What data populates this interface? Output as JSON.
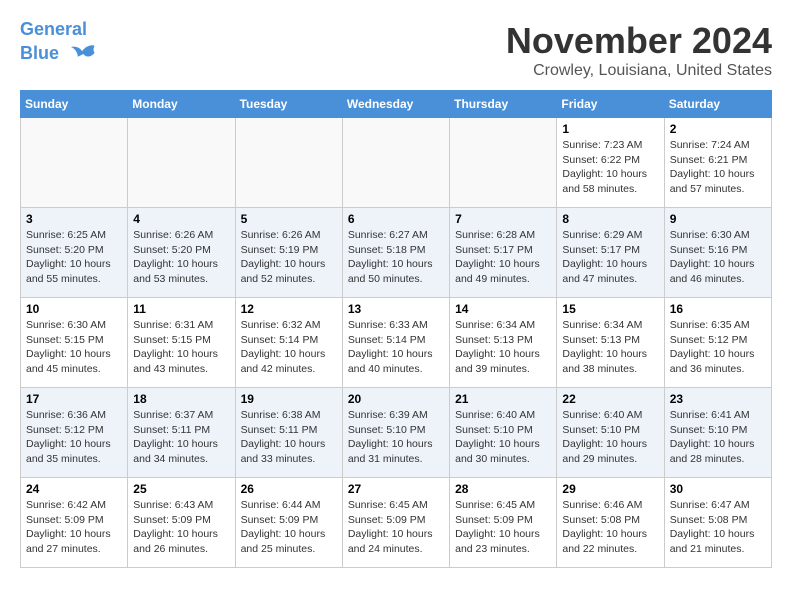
{
  "header": {
    "logo_line1": "General",
    "logo_line2": "Blue",
    "month": "November 2024",
    "location": "Crowley, Louisiana, United States"
  },
  "weekdays": [
    "Sunday",
    "Monday",
    "Tuesday",
    "Wednesday",
    "Thursday",
    "Friday",
    "Saturday"
  ],
  "weeks": [
    [
      {
        "day": "",
        "info": ""
      },
      {
        "day": "",
        "info": ""
      },
      {
        "day": "",
        "info": ""
      },
      {
        "day": "",
        "info": ""
      },
      {
        "day": "",
        "info": ""
      },
      {
        "day": "1",
        "info": "Sunrise: 7:23 AM\nSunset: 6:22 PM\nDaylight: 10 hours\nand 58 minutes."
      },
      {
        "day": "2",
        "info": "Sunrise: 7:24 AM\nSunset: 6:21 PM\nDaylight: 10 hours\nand 57 minutes."
      }
    ],
    [
      {
        "day": "3",
        "info": "Sunrise: 6:25 AM\nSunset: 5:20 PM\nDaylight: 10 hours\nand 55 minutes."
      },
      {
        "day": "4",
        "info": "Sunrise: 6:26 AM\nSunset: 5:20 PM\nDaylight: 10 hours\nand 53 minutes."
      },
      {
        "day": "5",
        "info": "Sunrise: 6:26 AM\nSunset: 5:19 PM\nDaylight: 10 hours\nand 52 minutes."
      },
      {
        "day": "6",
        "info": "Sunrise: 6:27 AM\nSunset: 5:18 PM\nDaylight: 10 hours\nand 50 minutes."
      },
      {
        "day": "7",
        "info": "Sunrise: 6:28 AM\nSunset: 5:17 PM\nDaylight: 10 hours\nand 49 minutes."
      },
      {
        "day": "8",
        "info": "Sunrise: 6:29 AM\nSunset: 5:17 PM\nDaylight: 10 hours\nand 47 minutes."
      },
      {
        "day": "9",
        "info": "Sunrise: 6:30 AM\nSunset: 5:16 PM\nDaylight: 10 hours\nand 46 minutes."
      }
    ],
    [
      {
        "day": "10",
        "info": "Sunrise: 6:30 AM\nSunset: 5:15 PM\nDaylight: 10 hours\nand 45 minutes."
      },
      {
        "day": "11",
        "info": "Sunrise: 6:31 AM\nSunset: 5:15 PM\nDaylight: 10 hours\nand 43 minutes."
      },
      {
        "day": "12",
        "info": "Sunrise: 6:32 AM\nSunset: 5:14 PM\nDaylight: 10 hours\nand 42 minutes."
      },
      {
        "day": "13",
        "info": "Sunrise: 6:33 AM\nSunset: 5:14 PM\nDaylight: 10 hours\nand 40 minutes."
      },
      {
        "day": "14",
        "info": "Sunrise: 6:34 AM\nSunset: 5:13 PM\nDaylight: 10 hours\nand 39 minutes."
      },
      {
        "day": "15",
        "info": "Sunrise: 6:34 AM\nSunset: 5:13 PM\nDaylight: 10 hours\nand 38 minutes."
      },
      {
        "day": "16",
        "info": "Sunrise: 6:35 AM\nSunset: 5:12 PM\nDaylight: 10 hours\nand 36 minutes."
      }
    ],
    [
      {
        "day": "17",
        "info": "Sunrise: 6:36 AM\nSunset: 5:12 PM\nDaylight: 10 hours\nand 35 minutes."
      },
      {
        "day": "18",
        "info": "Sunrise: 6:37 AM\nSunset: 5:11 PM\nDaylight: 10 hours\nand 34 minutes."
      },
      {
        "day": "19",
        "info": "Sunrise: 6:38 AM\nSunset: 5:11 PM\nDaylight: 10 hours\nand 33 minutes."
      },
      {
        "day": "20",
        "info": "Sunrise: 6:39 AM\nSunset: 5:10 PM\nDaylight: 10 hours\nand 31 minutes."
      },
      {
        "day": "21",
        "info": "Sunrise: 6:40 AM\nSunset: 5:10 PM\nDaylight: 10 hours\nand 30 minutes."
      },
      {
        "day": "22",
        "info": "Sunrise: 6:40 AM\nSunset: 5:10 PM\nDaylight: 10 hours\nand 29 minutes."
      },
      {
        "day": "23",
        "info": "Sunrise: 6:41 AM\nSunset: 5:10 PM\nDaylight: 10 hours\nand 28 minutes."
      }
    ],
    [
      {
        "day": "24",
        "info": "Sunrise: 6:42 AM\nSunset: 5:09 PM\nDaylight: 10 hours\nand 27 minutes."
      },
      {
        "day": "25",
        "info": "Sunrise: 6:43 AM\nSunset: 5:09 PM\nDaylight: 10 hours\nand 26 minutes."
      },
      {
        "day": "26",
        "info": "Sunrise: 6:44 AM\nSunset: 5:09 PM\nDaylight: 10 hours\nand 25 minutes."
      },
      {
        "day": "27",
        "info": "Sunrise: 6:45 AM\nSunset: 5:09 PM\nDaylight: 10 hours\nand 24 minutes."
      },
      {
        "day": "28",
        "info": "Sunrise: 6:45 AM\nSunset: 5:09 PM\nDaylight: 10 hours\nand 23 minutes."
      },
      {
        "day": "29",
        "info": "Sunrise: 6:46 AM\nSunset: 5:08 PM\nDaylight: 10 hours\nand 22 minutes."
      },
      {
        "day": "30",
        "info": "Sunrise: 6:47 AM\nSunset: 5:08 PM\nDaylight: 10 hours\nand 21 minutes."
      }
    ]
  ]
}
